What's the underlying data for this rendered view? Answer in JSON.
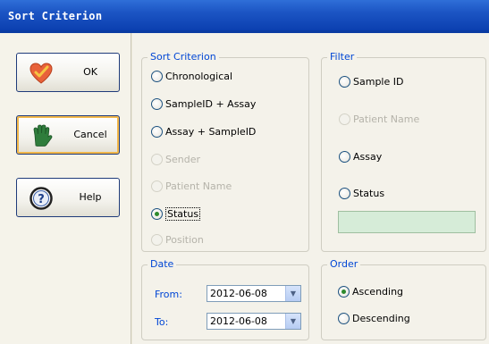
{
  "window": {
    "title": "Sort Criterion"
  },
  "buttons": {
    "ok": "OK",
    "cancel": "Cancel",
    "help": "Help"
  },
  "sort_criterion": {
    "legend": "Sort Criterion",
    "options": [
      {
        "label": "Chronological",
        "checked": false,
        "enabled": true
      },
      {
        "label": "SampleID + Assay",
        "checked": false,
        "enabled": true
      },
      {
        "label": "Assay + SampleID",
        "checked": false,
        "enabled": true
      },
      {
        "label": "Sender",
        "checked": false,
        "enabled": false
      },
      {
        "label": "Patient Name",
        "checked": false,
        "enabled": false
      },
      {
        "label": "Status",
        "checked": true,
        "enabled": true
      },
      {
        "label": "Position",
        "checked": false,
        "enabled": false
      }
    ]
  },
  "filter": {
    "legend": "Filter",
    "options": [
      {
        "label": "Sample ID",
        "checked": false,
        "enabled": true
      },
      {
        "label": "Patient Name",
        "checked": false,
        "enabled": false
      },
      {
        "label": "Assay",
        "checked": false,
        "enabled": true
      },
      {
        "label": "Status",
        "checked": false,
        "enabled": true
      }
    ],
    "value": ""
  },
  "date": {
    "legend": "Date",
    "from_label": "From:",
    "from_value": "2012-06-08",
    "to_label": "To:",
    "to_value": "2012-06-08"
  },
  "order": {
    "legend": "Order",
    "options": [
      {
        "label": "Ascending",
        "checked": true
      },
      {
        "label": "Descending",
        "checked": false
      }
    ]
  },
  "colors": {
    "titlebar": "#1c55c4",
    "legend_text": "#0046d5",
    "filter_box": "#d6ecd8",
    "button_focus": "#f2b74a"
  }
}
